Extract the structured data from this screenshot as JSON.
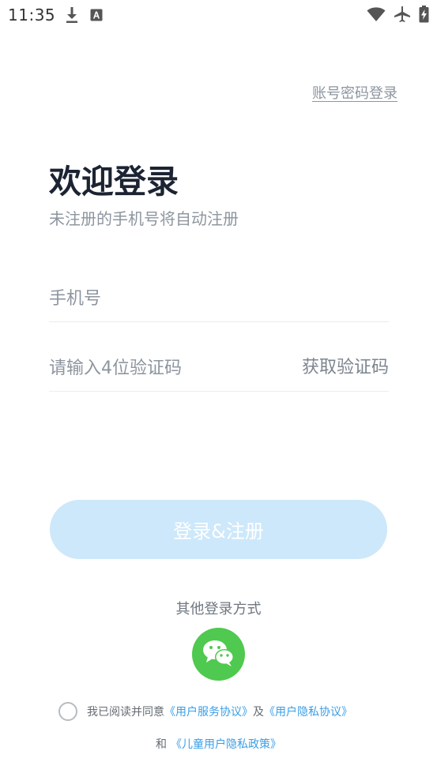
{
  "status_bar": {
    "time": "11:35",
    "left_icons": [
      "download-icon",
      "keyboard-a-icon"
    ],
    "right_icons": [
      "wifi-icon",
      "airplane-icon",
      "battery-charging-icon"
    ]
  },
  "header": {
    "account_login_link": "账号密码登录"
  },
  "welcome": {
    "title": "欢迎登录",
    "subtitle": "未注册的手机号将自动注册"
  },
  "form": {
    "phone_value": "",
    "phone_placeholder": "手机号",
    "code_value": "",
    "code_placeholder": "请输入4位验证码",
    "get_code_label": "获取验证码",
    "submit_label": "登录&注册"
  },
  "other_login": {
    "label": "其他登录方式",
    "wechat_icon": "wechat-icon"
  },
  "agreement": {
    "checked": false,
    "prefix": "我已阅读并同意",
    "service_link": "《用户服务协议》",
    "and_1": "及",
    "privacy_link": "《用户隐私协议》",
    "and_2": "和",
    "children_link": "《儿童用户隐私政策》"
  },
  "colors": {
    "primary_disabled": "#cde8fa",
    "link": "#3a9ee6",
    "wechat": "#4fc94f",
    "title": "#1c2433",
    "muted": "#8d959f"
  }
}
